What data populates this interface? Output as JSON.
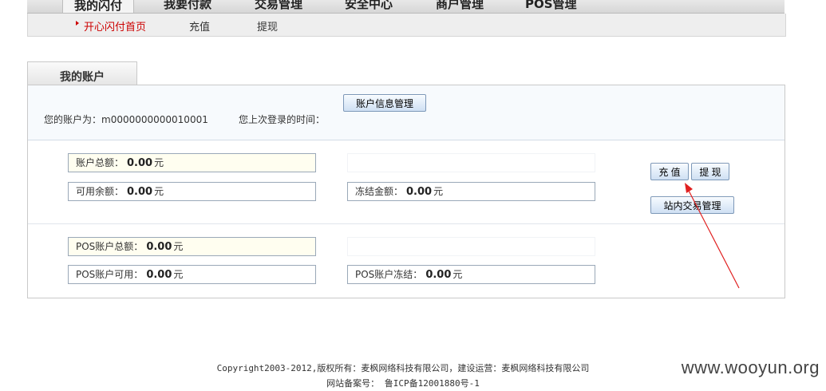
{
  "top_nav": {
    "items": [
      "我的闪付",
      "我要付款",
      "交易管理",
      "安全中心",
      "商户管理",
      "POS管理"
    ]
  },
  "sub_nav": {
    "items": [
      "开心闪付首页",
      "充值",
      "提现"
    ]
  },
  "account_tab": {
    "label": "我的账户"
  },
  "account_info": {
    "account_label": "您的账户为：m0000000000010001",
    "last_login_label": "您上次登录的时间：",
    "manage_button": "账户信息管理"
  },
  "balances": {
    "total_label": "账户总额：",
    "total_value": "0.00",
    "available_label": "可用余额：",
    "available_value": "0.00",
    "frozen_label": "冻结金额：",
    "frozen_value": "0.00",
    "currency": "元"
  },
  "actions": {
    "recharge": "充 值",
    "withdraw": "提 现",
    "internal_trade": "站内交易管理"
  },
  "pos": {
    "total_label": "POS账户总额：",
    "total_value": "0.00",
    "available_label": "POS账户可用：",
    "available_value": "0.00",
    "frozen_label": "POS账户冻结：",
    "frozen_value": "0.00",
    "currency": "元"
  },
  "footer": {
    "copyright": "Copyright2003-2012,版权所有：麦枫网络科技有限公司，建设运营：麦枫网络科技有限公司",
    "icp": "网站备案号： 鲁ICP备12001880号-1"
  },
  "watermark": "www.wooyun.org",
  "colors": {
    "annotation": "#e02020",
    "current_nav": "#cc0000"
  }
}
